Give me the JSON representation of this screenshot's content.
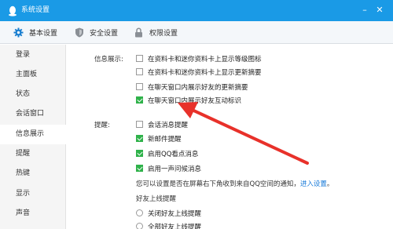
{
  "titlebar": {
    "title": "系统设置",
    "minimize_glyph": "–",
    "close_glyph": "✕",
    "bg_color": "#1a9ae6"
  },
  "tabs": [
    {
      "label": "基本设置",
      "icon": "gear-icon",
      "active": true
    },
    {
      "label": "安全设置",
      "icon": "shield-icon",
      "active": false
    },
    {
      "label": "权限设置",
      "icon": "lock-icon",
      "active": false
    }
  ],
  "sidebar": {
    "items": [
      {
        "label": "登录"
      },
      {
        "label": "主面板"
      },
      {
        "label": "状态"
      },
      {
        "label": "会话窗口"
      },
      {
        "label": "信息展示",
        "active": true
      },
      {
        "label": "提醒"
      },
      {
        "label": "热键"
      },
      {
        "label": "显示"
      },
      {
        "label": "声音"
      }
    ]
  },
  "info_display": {
    "label": "信息展示:",
    "options": [
      {
        "label": "在资料卡和迷你资料卡上显示等级图标",
        "checked": false
      },
      {
        "label": "在资料卡和迷你资料卡上显示更新摘要",
        "checked": false
      },
      {
        "label": "在聊天窗口内展示好友的更新摘要",
        "checked": false
      },
      {
        "label": "在聊天窗口内展示好友互动标识",
        "checked": true
      }
    ]
  },
  "reminder": {
    "label": "提醒:",
    "options": [
      {
        "label": "会话消息提醒",
        "checked": false
      },
      {
        "label": "新邮件提醒",
        "checked": true
      },
      {
        "label": "启用QQ看点消息",
        "checked": true
      },
      {
        "label": "启用一声问候消息",
        "checked": true
      }
    ],
    "note_prefix": "您可以设置是否在屏幕右下角收到来自QQ空间的通知，",
    "note_link": "进入设置",
    "note_suffix": "。",
    "online_label": "好友上线提醒",
    "radios": [
      {
        "label": "关闭好友上线提醒",
        "selected": false
      },
      {
        "label": "全部好友上线提醒",
        "selected": false
      }
    ]
  },
  "colors": {
    "accent": "#1a9ae6",
    "check_green": "#2fb24a",
    "link_blue": "#1478d8",
    "arrow_red": "#e8312a"
  }
}
